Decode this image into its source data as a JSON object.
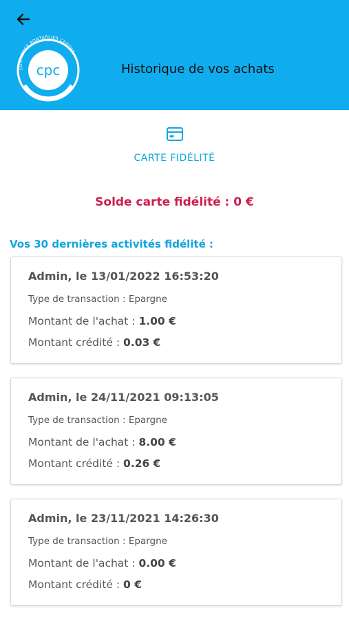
{
  "header": {
    "title": "Historique de vos achats",
    "logo": {
      "text": "cpc",
      "ring_text": "COMMERCE PONTARLIER CENTRE"
    },
    "back_icon": "arrow-left-icon",
    "color": "#10ADEE"
  },
  "tab": {
    "icon": "card-icon",
    "label": "CARTE FIDÉLITÉ"
  },
  "balance": {
    "label": "Solde carte fidélité :",
    "value": "0 €"
  },
  "section_title": "Vos 30 dernières activités fidélité :",
  "transactions": [
    {
      "head": "Admin, le 13/01/2022 16:53:20",
      "type": "Type de transaction : Epargne",
      "amount_label": "Montant de l'achat :",
      "amount_value": "1.00 €",
      "credit_label": "Montant crédité :",
      "credit_value": "0.03 €"
    },
    {
      "head": "Admin, le 24/11/2021 09:13:05",
      "type": "Type de transaction : Epargne",
      "amount_label": "Montant de l'achat :",
      "amount_value": "8.00 €",
      "credit_label": "Montant crédité :",
      "credit_value": "0.26 €"
    },
    {
      "head": "Admin, le 23/11/2021 14:26:30",
      "type": "Type de transaction : Epargne",
      "amount_label": "Montant de l'achat :",
      "amount_value": "0.00 €",
      "credit_label": "Montant crédité :",
      "credit_value": "0 €"
    }
  ],
  "colors": {
    "accent": "#10A5DD",
    "balance": "#CC1F4F"
  }
}
